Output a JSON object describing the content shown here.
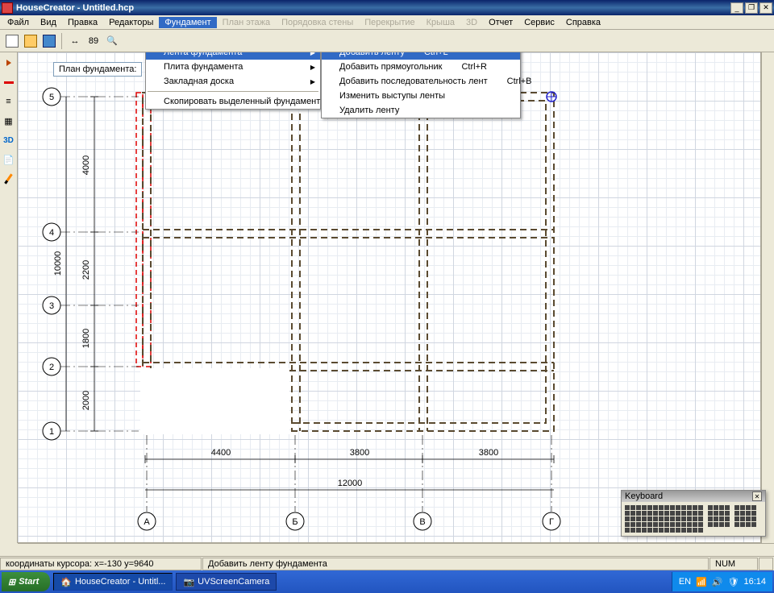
{
  "title": "HouseCreator - Untitled.hcp",
  "menubar": [
    "Файл",
    "Вид",
    "Правка",
    "Редакторы",
    "Фундамент",
    "План этажа",
    "Порядовка стены",
    "Перекрытие",
    "Крыша",
    "3D",
    "Отчет",
    "Сервис",
    "Справка"
  ],
  "menubar_open_index": 4,
  "menubar_dim_indexes": [
    5,
    6,
    7,
    8,
    9
  ],
  "toolbar_zoom_label": "89",
  "plan_label": "План фундамента:",
  "dropdown1": {
    "items": [
      {
        "label": "Лента фундамента",
        "arrow": true,
        "hi": true
      },
      {
        "label": "Плита фундамента",
        "arrow": true
      },
      {
        "label": "Закладная доска",
        "arrow": true
      },
      {
        "sep": true
      },
      {
        "label": "Скопировать выделенный фундамент"
      }
    ]
  },
  "dropdown2": {
    "items": [
      {
        "label": "Добавить ленту",
        "shortcut": "Ctrl+L",
        "hi": true
      },
      {
        "label": "Добавить прямоугольник",
        "shortcut": "Ctrl+R"
      },
      {
        "label": "Добавить последовательность лент",
        "shortcut": "Ctrl+B"
      },
      {
        "label": "Изменить выступы ленты"
      },
      {
        "label": "Удалить ленту"
      }
    ]
  },
  "axes_numbers": [
    "5",
    "4",
    "3",
    "2",
    "1"
  ],
  "axes_letters": [
    "А",
    "Б",
    "В",
    "Г"
  ],
  "dims_v": [
    "4000",
    "2200",
    "1800",
    "2000"
  ],
  "dims_v_total": "10000",
  "dims_h": [
    "4400",
    "3800",
    "3800"
  ],
  "dims_h_total": "12000",
  "status": {
    "coords": "координаты курсора: x=-130 y=9640",
    "hint": "Добавить ленту фундамента",
    "mode": "NUM"
  },
  "keyboard_title": "Keyboard",
  "taskbar": {
    "start": "Start",
    "buttons": [
      "HouseCreator - Untitl...",
      "UVScreenCamera"
    ],
    "lang": "EN",
    "clock": "16:14"
  }
}
